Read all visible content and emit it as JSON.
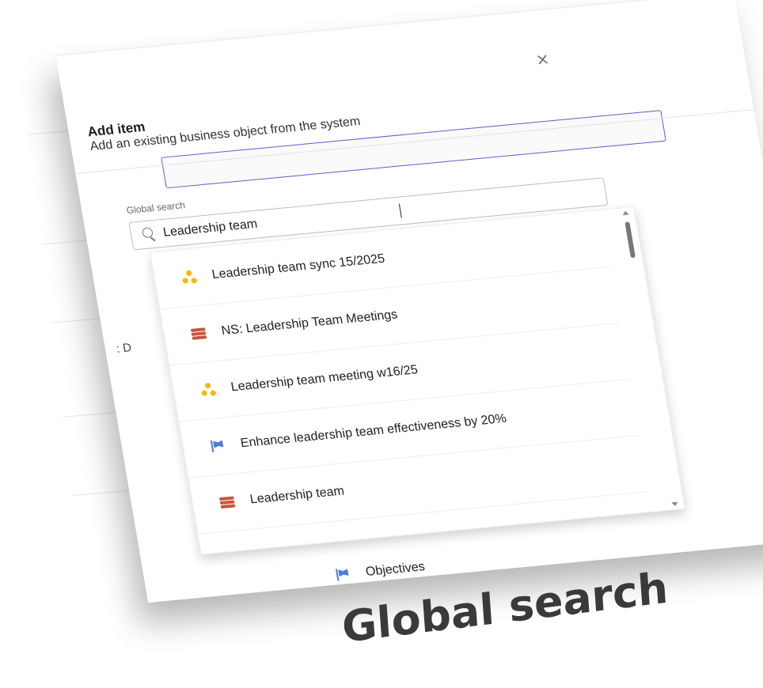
{
  "dialog": {
    "title": "Add item",
    "subtitle": "Add an existing business object from the system",
    "close_icon": "close-icon"
  },
  "search": {
    "label": "Global search",
    "value": "Leadership team",
    "icon": "search-icon"
  },
  "results": [
    {
      "label": "Leadership team sync 15/2025",
      "icon": "meeting-icon",
      "color": "#f5b800"
    },
    {
      "label": "NS: Leadership Team Meetings",
      "icon": "stack-icon",
      "color": "#c8553d"
    },
    {
      "label": "Leadership team meeting w16/25",
      "icon": "meeting-icon",
      "color": "#f5b800"
    },
    {
      "label": "Enhance leadership team effectiveness by 20%",
      "icon": "flag-icon",
      "color": "#4a7dde"
    },
    {
      "label": "Leadership team",
      "icon": "stack-icon",
      "color": "#c8553d"
    }
  ],
  "background": {
    "row_label": "Objectives",
    "row_icon": "flag-icon",
    "fragment": ": D"
  },
  "caption": "Global search",
  "colors": {
    "accent": "#5b5fc7",
    "meeting": "#f5b800",
    "stack": "#c8553d",
    "flag": "#4a7dde"
  }
}
